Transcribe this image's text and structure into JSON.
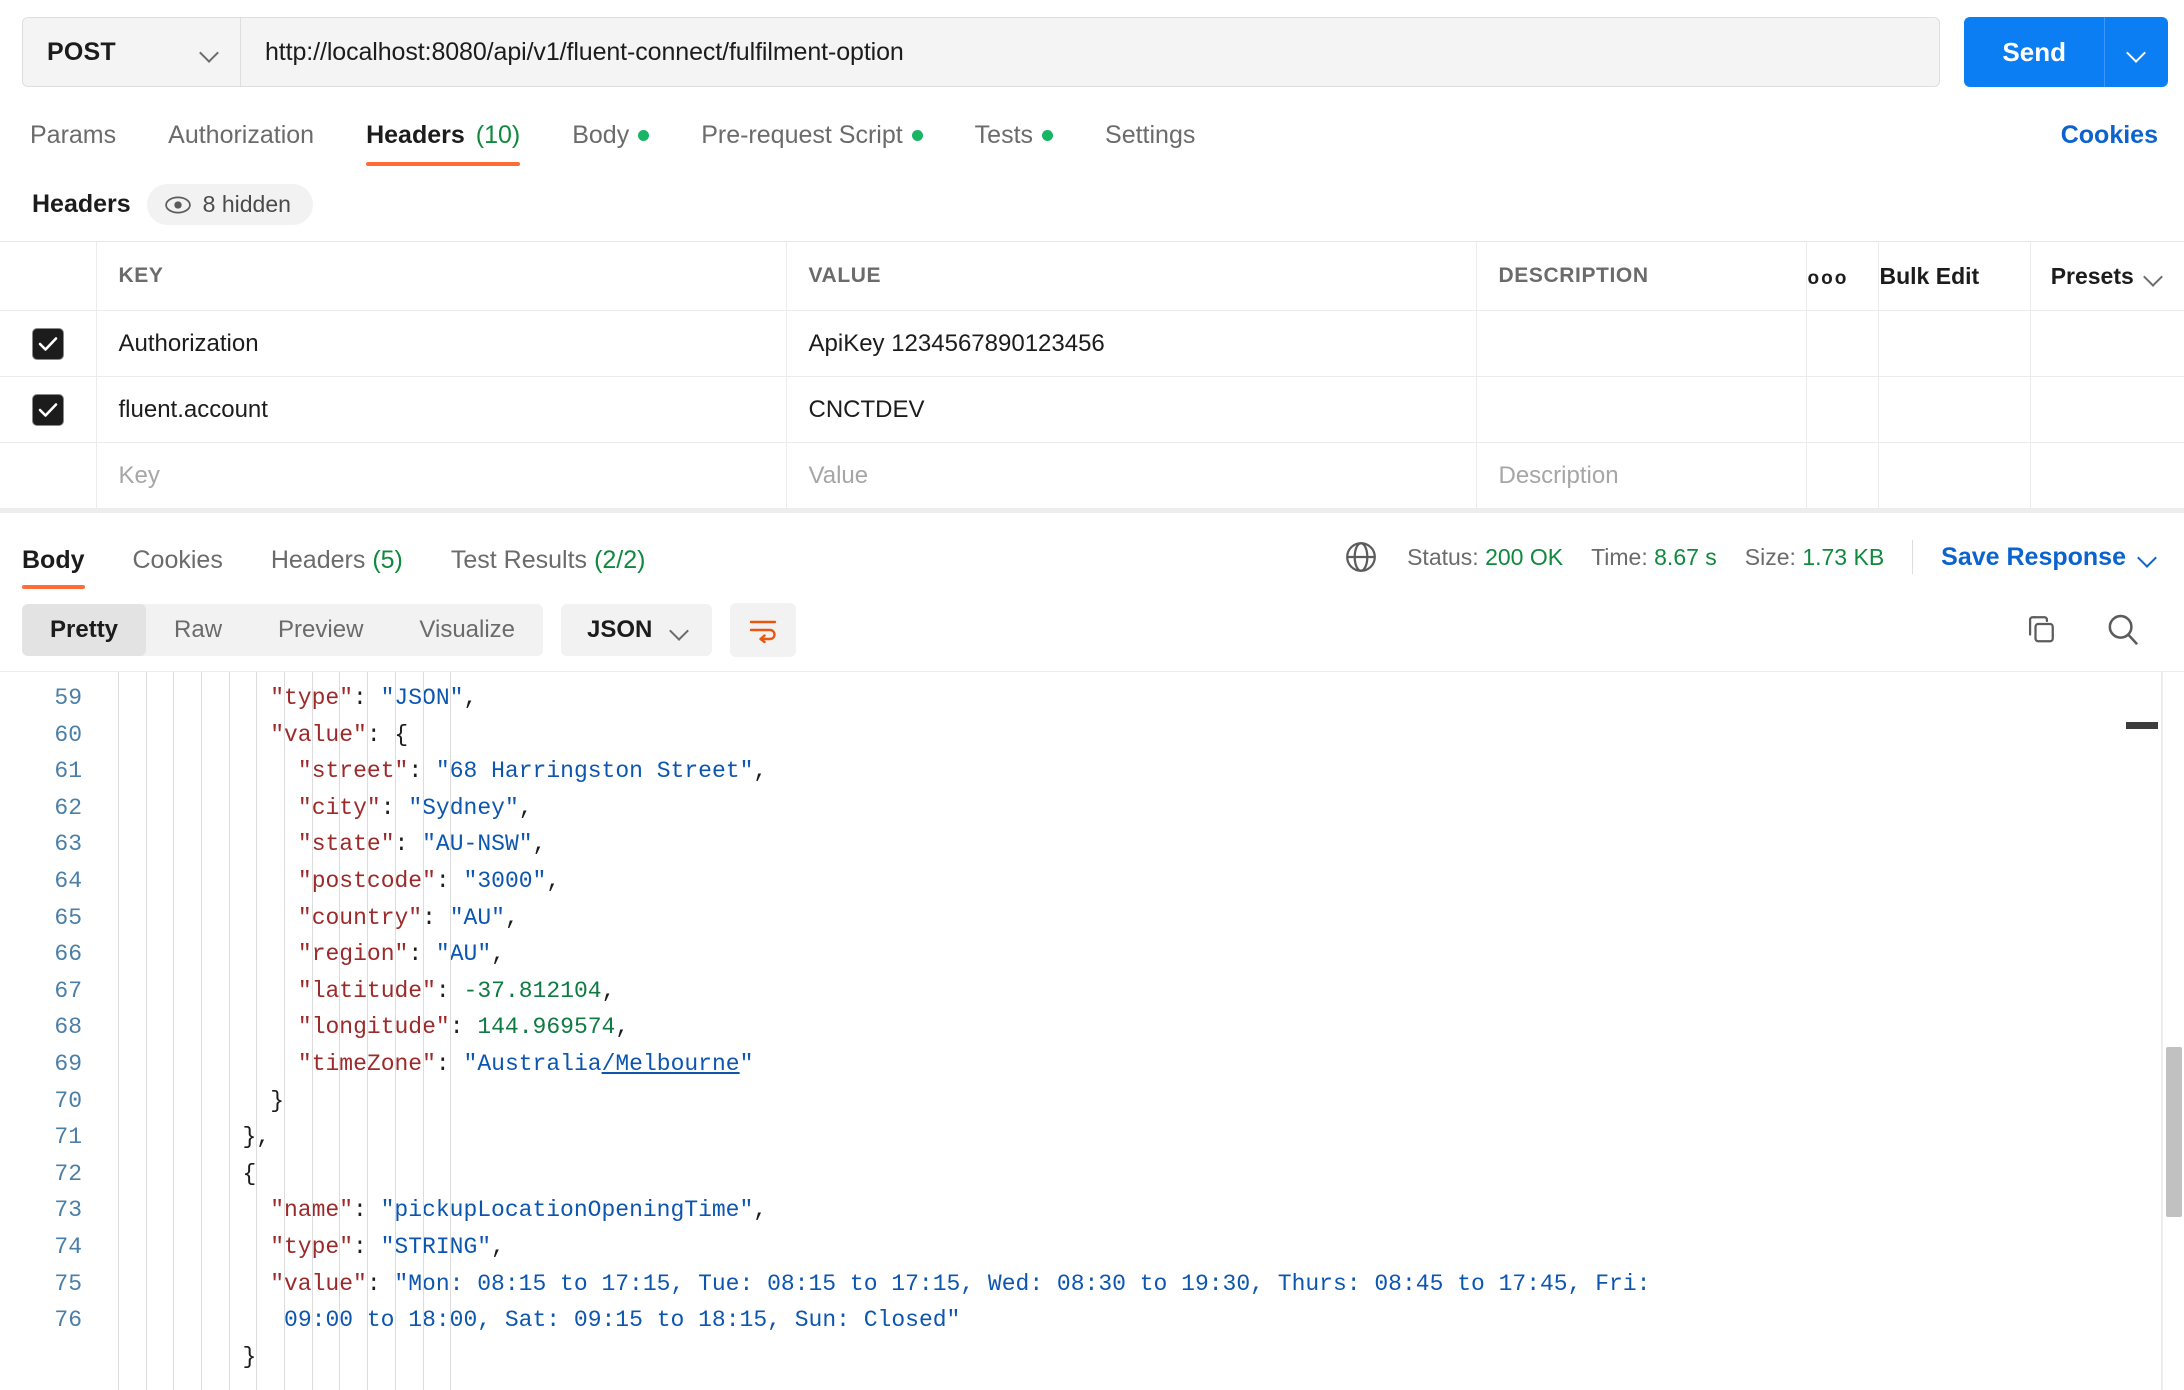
{
  "request": {
    "method": "POST",
    "url": "http://localhost:8080/api/v1/fluent-connect/fulfilment-option",
    "send_label": "Send",
    "tabs": [
      {
        "label": "Params",
        "count": "",
        "dot": false,
        "active": false
      },
      {
        "label": "Authorization",
        "count": "",
        "dot": false,
        "active": false
      },
      {
        "label": "Headers",
        "count": "(10)",
        "dot": false,
        "active": true
      },
      {
        "label": "Body",
        "count": "",
        "dot": true,
        "active": false
      },
      {
        "label": "Pre-request Script",
        "count": "",
        "dot": true,
        "active": false
      },
      {
        "label": "Tests",
        "count": "",
        "dot": true,
        "active": false
      },
      {
        "label": "Settings",
        "count": "",
        "dot": false,
        "active": false
      }
    ],
    "cookies_link": "Cookies"
  },
  "headers_section": {
    "title": "Headers",
    "hidden_pill": "8 hidden",
    "columns": {
      "key": "KEY",
      "value": "VALUE",
      "description": "DESCRIPTION",
      "more": "ooo",
      "bulk_edit": "Bulk Edit",
      "presets": "Presets"
    },
    "rows": [
      {
        "checked": true,
        "key": "Authorization",
        "value": "ApiKey 1234567890123456",
        "description": ""
      },
      {
        "checked": true,
        "key": "fluent.account",
        "value": "CNCTDEV",
        "description": ""
      }
    ],
    "new_row": {
      "key_placeholder": "Key",
      "value_placeholder": "Value",
      "description_placeholder": "Description"
    }
  },
  "response": {
    "tabs": [
      {
        "label": "Body",
        "count": "",
        "active": true
      },
      {
        "label": "Cookies",
        "count": "",
        "active": false
      },
      {
        "label": "Headers",
        "count": "(5)",
        "active": false
      },
      {
        "label": "Test Results",
        "count": "(2/2)",
        "active": false
      }
    ],
    "status_label": "Status:",
    "status_value": "200 OK",
    "time_label": "Time:",
    "time_value": "8.67 s",
    "size_label": "Size:",
    "size_value": "1.73 KB",
    "save_response": "Save Response",
    "view_modes": [
      {
        "label": "Pretty",
        "active": true
      },
      {
        "label": "Raw",
        "active": false
      },
      {
        "label": "Preview",
        "active": false
      },
      {
        "label": "Visualize",
        "active": false
      }
    ],
    "format": "JSON"
  },
  "colors": {
    "accent": "#ff6c37",
    "send_blue": "#0b7ef4",
    "link_blue": "#0b63ce",
    "status_green": "#10893e",
    "json_key": "#9c2a2a",
    "json_string": "#0d56b0",
    "json_number": "#0f7a42",
    "line_number": "#4a7fa8"
  },
  "code": {
    "first_line_number": 59,
    "lines": [
      {
        "num": "59",
        "indent": 12,
        "tokens": [
          {
            "t": "\"type\"",
            "c": "k"
          },
          {
            "t": ": ",
            "c": "p"
          },
          {
            "t": "\"JSON\"",
            "c": "s"
          },
          {
            "t": ",",
            "c": "p"
          }
        ]
      },
      {
        "num": "60",
        "indent": 12,
        "tokens": [
          {
            "t": "\"value\"",
            "c": "k"
          },
          {
            "t": ": {",
            "c": "p"
          }
        ]
      },
      {
        "num": "61",
        "indent": 14,
        "tokens": [
          {
            "t": "\"street\"",
            "c": "k"
          },
          {
            "t": ": ",
            "c": "p"
          },
          {
            "t": "\"68 Harringston Street\"",
            "c": "s"
          },
          {
            "t": ",",
            "c": "p"
          }
        ]
      },
      {
        "num": "62",
        "indent": 14,
        "tokens": [
          {
            "t": "\"city\"",
            "c": "k"
          },
          {
            "t": ": ",
            "c": "p"
          },
          {
            "t": "\"Sydney\"",
            "c": "s"
          },
          {
            "t": ",",
            "c": "p"
          }
        ]
      },
      {
        "num": "63",
        "indent": 14,
        "tokens": [
          {
            "t": "\"state\"",
            "c": "k"
          },
          {
            "t": ": ",
            "c": "p"
          },
          {
            "t": "\"AU-NSW\"",
            "c": "s"
          },
          {
            "t": ",",
            "c": "p"
          }
        ]
      },
      {
        "num": "64",
        "indent": 14,
        "tokens": [
          {
            "t": "\"postcode\"",
            "c": "k"
          },
          {
            "t": ": ",
            "c": "p"
          },
          {
            "t": "\"3000\"",
            "c": "s"
          },
          {
            "t": ",",
            "c": "p"
          }
        ]
      },
      {
        "num": "65",
        "indent": 14,
        "tokens": [
          {
            "t": "\"country\"",
            "c": "k"
          },
          {
            "t": ": ",
            "c": "p"
          },
          {
            "t": "\"AU\"",
            "c": "s"
          },
          {
            "t": ",",
            "c": "p"
          }
        ]
      },
      {
        "num": "66",
        "indent": 14,
        "tokens": [
          {
            "t": "\"region\"",
            "c": "k"
          },
          {
            "t": ": ",
            "c": "p"
          },
          {
            "t": "\"AU\"",
            "c": "s"
          },
          {
            "t": ",",
            "c": "p"
          }
        ]
      },
      {
        "num": "67",
        "indent": 14,
        "tokens": [
          {
            "t": "\"latitude\"",
            "c": "k"
          },
          {
            "t": ": ",
            "c": "p"
          },
          {
            "t": "-37.812104",
            "c": "n"
          },
          {
            "t": ",",
            "c": "p"
          }
        ]
      },
      {
        "num": "68",
        "indent": 14,
        "tokens": [
          {
            "t": "\"longitude\"",
            "c": "k"
          },
          {
            "t": ": ",
            "c": "p"
          },
          {
            "t": "144.969574",
            "c": "n"
          },
          {
            "t": ",",
            "c": "p"
          }
        ]
      },
      {
        "num": "69",
        "indent": 14,
        "tokens": [
          {
            "t": "\"timeZone\"",
            "c": "k"
          },
          {
            "t": ": ",
            "c": "p"
          },
          {
            "t": "\"Australia",
            "c": "s"
          },
          {
            "t": "/Melbourne",
            "c": "s lnk"
          },
          {
            "t": "\"",
            "c": "s"
          }
        ]
      },
      {
        "num": "70",
        "indent": 12,
        "tokens": [
          {
            "t": "}",
            "c": "p"
          }
        ]
      },
      {
        "num": "71",
        "indent": 10,
        "tokens": [
          {
            "t": "},",
            "c": "p"
          }
        ]
      },
      {
        "num": "72",
        "indent": 10,
        "tokens": [
          {
            "t": "{",
            "c": "p"
          }
        ]
      },
      {
        "num": "73",
        "indent": 12,
        "tokens": [
          {
            "t": "\"name\"",
            "c": "k"
          },
          {
            "t": ": ",
            "c": "p"
          },
          {
            "t": "\"pickupLocationOpeningTime\"",
            "c": "s"
          },
          {
            "t": ",",
            "c": "p"
          }
        ]
      },
      {
        "num": "74",
        "indent": 12,
        "tokens": [
          {
            "t": "\"type\"",
            "c": "k"
          },
          {
            "t": ": ",
            "c": "p"
          },
          {
            "t": "\"STRING\"",
            "c": "s"
          },
          {
            "t": ",",
            "c": "p"
          }
        ]
      },
      {
        "num": "75",
        "indent": 12,
        "tokens": [
          {
            "t": "\"value\"",
            "c": "k"
          },
          {
            "t": ": ",
            "c": "p"
          },
          {
            "t": "\"Mon: 08:15 to 17:15, Tue: 08:15 to 17:15, Wed: 08:30 to 19:30, Thurs: 08:45 to 17:45, Fri:",
            "c": "s"
          }
        ]
      },
      {
        "num": "",
        "indent": 13,
        "tokens": [
          {
            "t": "09:00 to 18:00, Sat: 09:15 to 18:15, Sun: Closed\"",
            "c": "s"
          }
        ]
      },
      {
        "num": "76",
        "indent": 10,
        "tokens": [
          {
            "t": "}",
            "c": "p"
          }
        ]
      }
    ]
  }
}
